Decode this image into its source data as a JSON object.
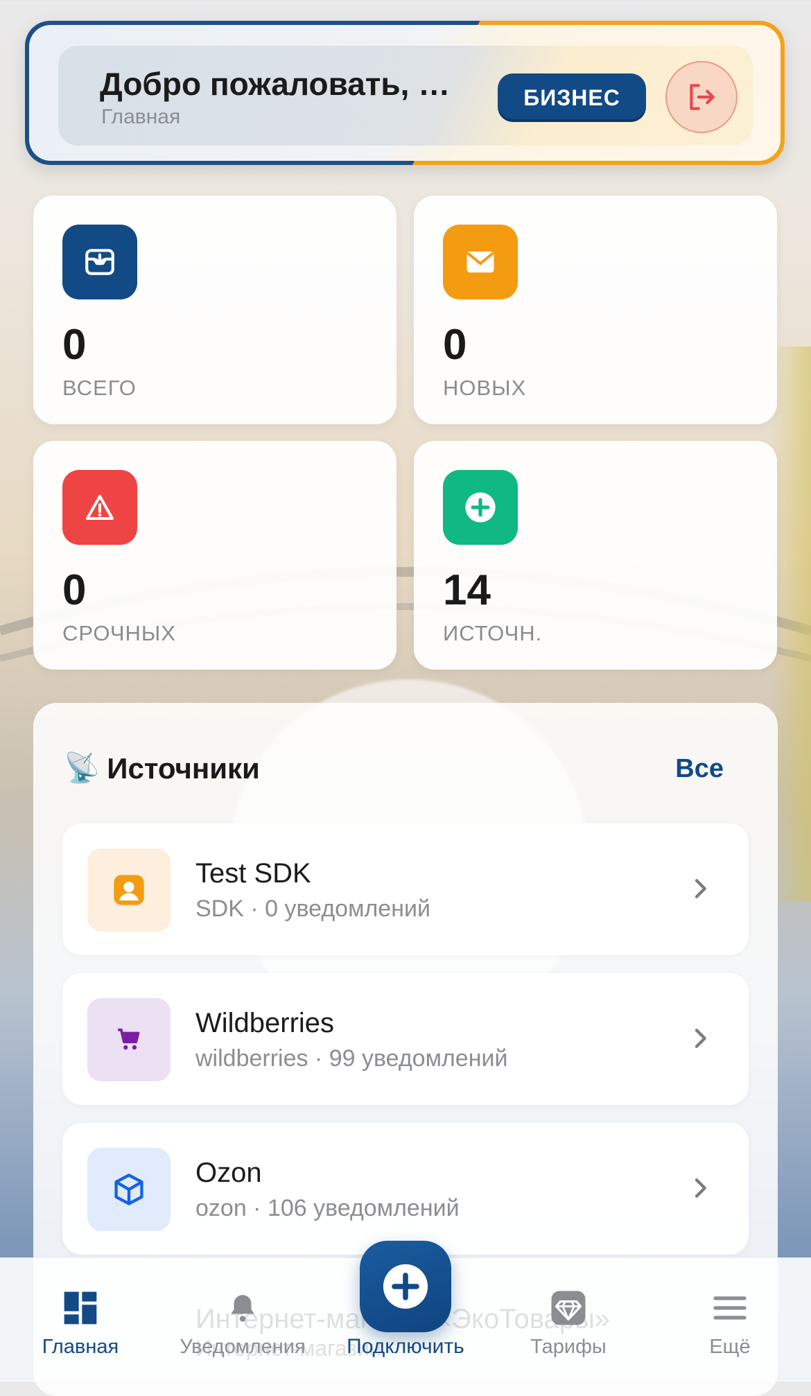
{
  "header": {
    "welcome_title": "Добро пожаловать, …",
    "subtitle": "Главная",
    "plan_badge": "БИЗНЕС",
    "logout_icon": "logout-icon"
  },
  "stats": [
    {
      "value": "0",
      "label": "ВСЕГО",
      "color": "#124a86",
      "icon": "inbox-download-icon"
    },
    {
      "value": "0",
      "label": "НОВЫХ",
      "color": "#f39c12",
      "icon": "envelope-icon"
    },
    {
      "value": "0",
      "label": "СРОЧНЫХ",
      "color": "#ef4444",
      "icon": "warning-icon"
    },
    {
      "value": "14",
      "label": "ИСТОЧН.",
      "color": "#10b981",
      "icon": "plus-circle-icon"
    }
  ],
  "sources": {
    "title": "Источники",
    "title_emoji": "📡",
    "all_link": "Все",
    "items": [
      {
        "name": "Test SDK",
        "meta": "SDK · 0 уведомлений",
        "icon": "user-icon",
        "icon_bg": "#fdeedd",
        "icon_color": "#f39c12"
      },
      {
        "name": "Wildberries",
        "meta": "wildberries · 99 уведомлений",
        "icon": "cart-icon",
        "icon_bg": "#ece0f3",
        "icon_color": "#7b1fa2"
      },
      {
        "name": "Ozon",
        "meta": "ozon · 106 уведомлений",
        "icon": "cube-icon",
        "icon_bg": "#e1ebfb",
        "icon_color": "#1463e6"
      }
    ],
    "partial_item": {
      "name": "Интернет-магазин «ЭкоТовары»",
      "meta": "Интернет-магазин"
    }
  },
  "tabbar": {
    "items": [
      {
        "label": "Главная",
        "icon": "dashboard-icon",
        "active": true
      },
      {
        "label": "Уведомления",
        "icon": "bell-icon",
        "active": false
      },
      {
        "label": "Подключить",
        "icon": "plus-icon",
        "active": false
      },
      {
        "label": "Тарифы",
        "icon": "diamond-icon",
        "active": false
      },
      {
        "label": "Ещё",
        "icon": "menu-icon",
        "active": false
      }
    ]
  }
}
